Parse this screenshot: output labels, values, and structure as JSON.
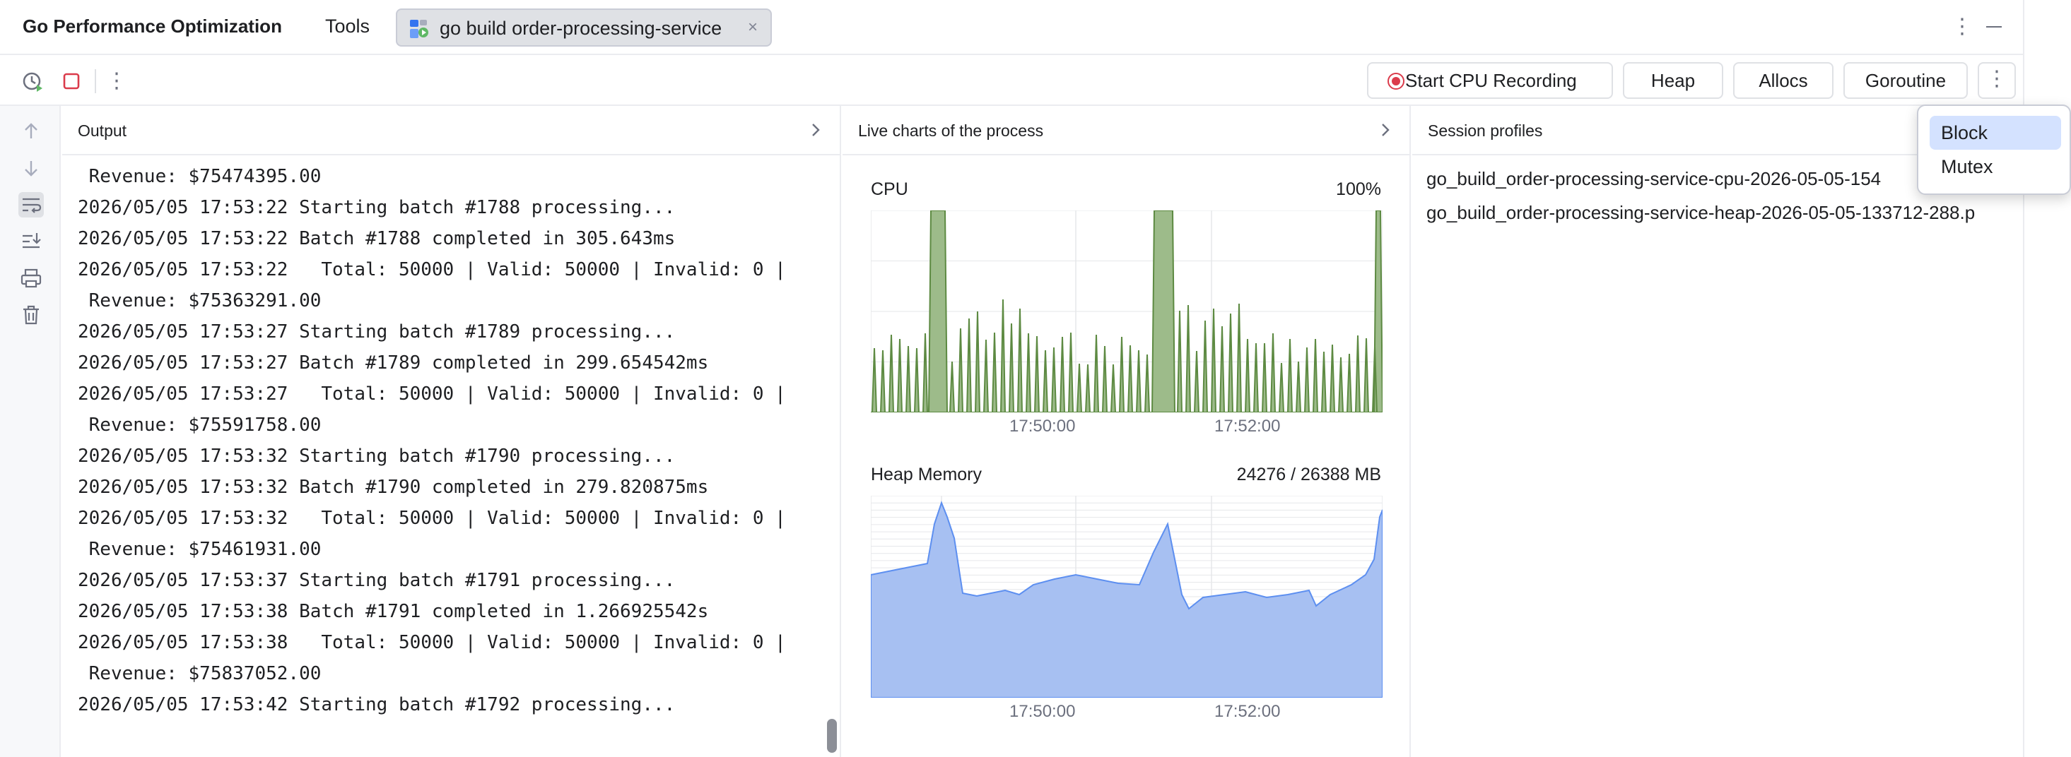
{
  "titlebar": {
    "app_title": "Go Performance Optimization",
    "tab_tools": "Tools",
    "run_tab_label": "go build order-processing-service",
    "close_glyph": "×",
    "more_glyph": "⋮"
  },
  "toolbar": {
    "more_glyph": "⋮",
    "start_cpu_recording": "Start CPU Recording",
    "heap": "Heap",
    "allocs": "Allocs",
    "goroutine": "Goroutine",
    "overflow_glyph": "⋮"
  },
  "icons": {
    "attach": "profiler-attach-icon",
    "stop": "stop-icon",
    "up": "arrow-up-icon",
    "down": "arrow-down-icon",
    "wrap": "soft-wrap-icon",
    "scroll_end": "scroll-to-end-icon",
    "print": "print-icon",
    "trash": "trash-icon"
  },
  "output": {
    "title": "Output",
    "lines": [
      " Revenue: $75474395.00",
      "2026/05/05 17:53:22 Starting batch #1788 processing...",
      "2026/05/05 17:53:22 Batch #1788 completed in 305.643ms",
      "2026/05/05 17:53:22   Total: 50000 | Valid: 50000 | Invalid: 0 |",
      " Revenue: $75363291.00",
      "2026/05/05 17:53:27 Starting batch #1789 processing...",
      "2026/05/05 17:53:27 Batch #1789 completed in 299.654542ms",
      "2026/05/05 17:53:27   Total: 50000 | Valid: 50000 | Invalid: 0 |",
      " Revenue: $75591758.00",
      "2026/05/05 17:53:32 Starting batch #1790 processing...",
      "2026/05/05 17:53:32 Batch #1790 completed in 279.820875ms",
      "2026/05/05 17:53:32   Total: 50000 | Valid: 50000 | Invalid: 0 |",
      " Revenue: $75461931.00",
      "2026/05/05 17:53:37 Starting batch #1791 processing...",
      "2026/05/05 17:53:38 Batch #1791 completed in 1.266925542s",
      "2026/05/05 17:53:38   Total: 50000 | Valid: 50000 | Invalid: 0 |",
      " Revenue: $75837052.00",
      "2026/05/05 17:53:42 Starting batch #1792 processing..."
    ]
  },
  "charts_panel": {
    "title": "Live charts of the process",
    "cpu": {
      "title": "CPU",
      "value": "100%",
      "ticks": [
        "17:50:00",
        "17:52:00"
      ],
      "color": "#5d8a42",
      "fill": "#9dbb8a"
    },
    "heap": {
      "title": "Heap Memory",
      "value": "24276 / 26388 MB",
      "ticks": [
        "17:50:00",
        "17:52:00"
      ],
      "color": "#5d8ff0",
      "fill": "#a7c0f2"
    }
  },
  "sessions": {
    "title": "Session profiles",
    "items": [
      "go_build_order-processing-service-cpu-2026-05-05-154",
      "go_build_order-processing-service-heap-2026-05-05-133712-288.p"
    ]
  },
  "popup": {
    "items": [
      "Block",
      "Mutex"
    ],
    "selected": "Block"
  }
}
